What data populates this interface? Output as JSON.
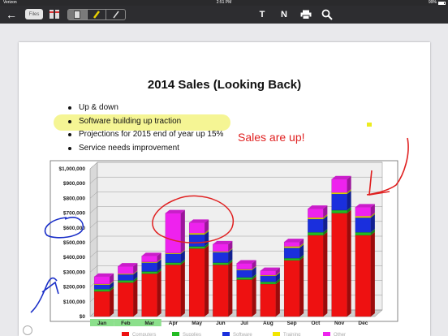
{
  "status_bar": {
    "carrier": "Verizon",
    "time": "2:51 PM",
    "battery": "99%"
  },
  "toolbar": {
    "back_icon": "arrow-left-icon",
    "pill_label": "Files",
    "book_icon": "book-icon",
    "segments": [
      "page-icon",
      "highlighter-icon",
      "pen-icon"
    ],
    "text_tool": "T",
    "note_tool": "N",
    "print_icon": "print-icon",
    "search_icon": "search-icon"
  },
  "slide": {
    "title": "2014 Sales (Looking Back)",
    "bullets": [
      "Up & down",
      "Software building up traction",
      "Projections for 2015 end of year up 15%",
      "Service needs improvement"
    ]
  },
  "annotation": {
    "text": "Sales are up!",
    "color": "#e02020"
  },
  "colors": {
    "highlight": "#f0f05a",
    "ink_red": "#e02020",
    "ink_blue": "#1a2fc8"
  },
  "chart_data": {
    "type": "bar",
    "stacked": true,
    "categories": [
      "Jan",
      "Feb",
      "Mar",
      "Apr",
      "May",
      "Jun",
      "Jul",
      "Aug",
      "Sep",
      "Oct",
      "Nov",
      "Dec"
    ],
    "series": [
      {
        "name": "Computers",
        "color": "#ee1111",
        "values": [
          170000,
          230000,
          290000,
          350000,
          460000,
          350000,
          250000,
          220000,
          380000,
          550000,
          700000,
          550000
        ]
      },
      {
        "name": "Supplies",
        "color": "#22bb22",
        "values": [
          15000,
          15000,
          15000,
          15000,
          15000,
          15000,
          15000,
          15000,
          15000,
          20000,
          20000,
          20000
        ]
      },
      {
        "name": "Software",
        "color": "#1a2fdd",
        "values": [
          30000,
          40000,
          60000,
          60000,
          80000,
          70000,
          50000,
          40000,
          70000,
          90000,
          110000,
          100000
        ]
      },
      {
        "name": "Training",
        "color": "#f2e600",
        "values": [
          5000,
          5000,
          5000,
          5000,
          10000,
          5000,
          5000,
          5000,
          10000,
          10000,
          10000,
          10000
        ]
      },
      {
        "name": "Other",
        "color": "#ee22ee",
        "values": [
          50000,
          50000,
          40000,
          270000,
          70000,
          50000,
          40000,
          30000,
          30000,
          60000,
          90000,
          60000
        ]
      }
    ],
    "yticks": [
      "$0",
      "$100,000",
      "$200,000",
      "$300,000",
      "$400,000",
      "$500,000",
      "$600,000",
      "$700,000",
      "$800,000",
      "$900,000",
      "$1,000,000"
    ],
    "ylim": [
      0,
      1000000
    ],
    "highlighted_categories": [
      "Jan",
      "Feb",
      "Mar"
    ]
  }
}
